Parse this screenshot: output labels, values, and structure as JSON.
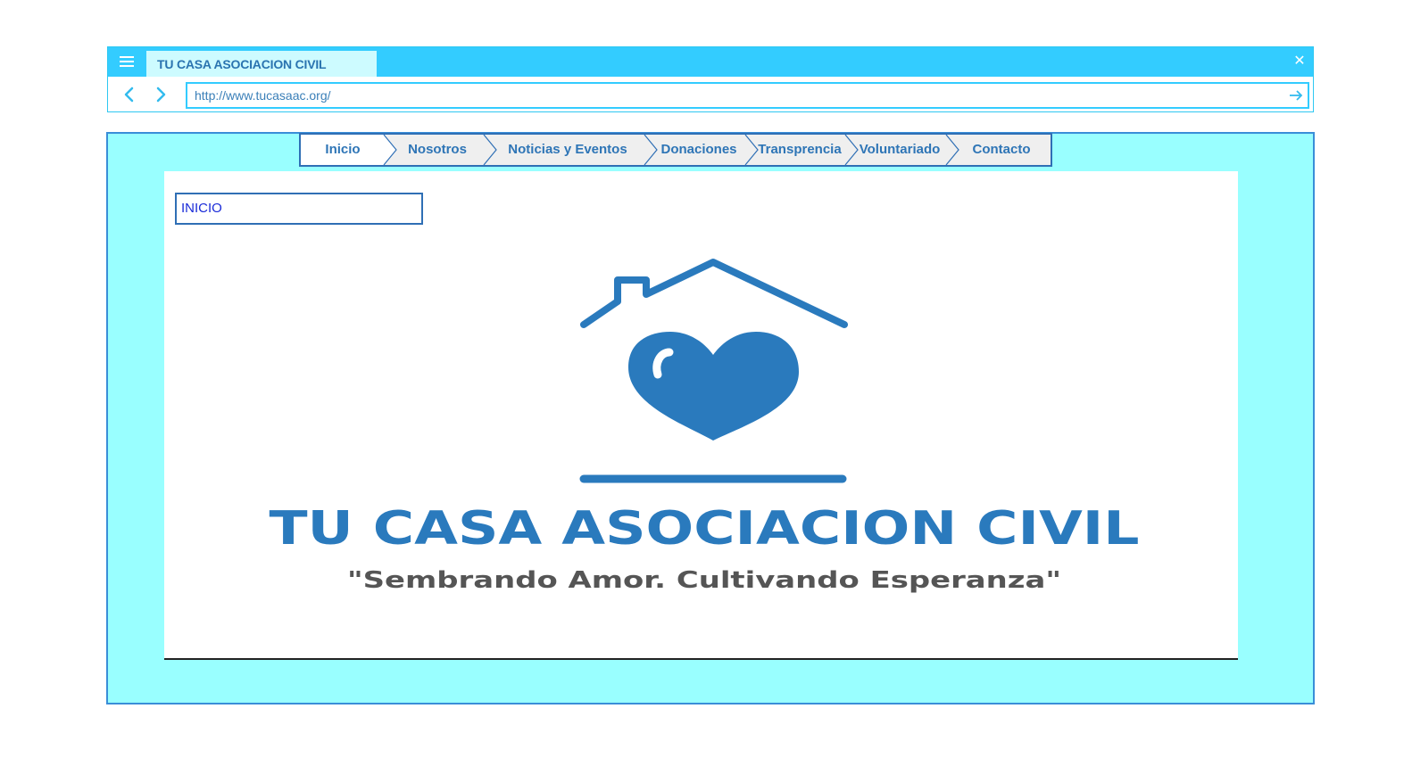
{
  "browser": {
    "tab_title": "TU CASA ASOCIACION CIVIL",
    "url": "http://www.tucasaac.org/",
    "icons": [
      "hamburger-menu-icon",
      "close-icon",
      "back-arrow-icon",
      "forward-arrow-icon",
      "go-arrow-icon"
    ]
  },
  "nav": {
    "items": [
      {
        "label": "Inicio"
      },
      {
        "label": "Nosotros"
      },
      {
        "label": "Noticias y Eventos"
      },
      {
        "label": "Donaciones"
      },
      {
        "label": "Transprencia"
      },
      {
        "label": "Voluntariado"
      },
      {
        "label": "Contacto"
      }
    ]
  },
  "main": {
    "breadcrumb": "INICIO",
    "logo": {
      "name": "TU CASA ASOCIACION CIVIL",
      "slogan": "\"Sembrando Amor. Cultivando Esperanza\""
    }
  },
  "colors": {
    "chrome_accent": "#33ccff",
    "page_background": "#99ffff",
    "brand_blue": "#2a7abd",
    "nav_text": "#2e75b6"
  }
}
